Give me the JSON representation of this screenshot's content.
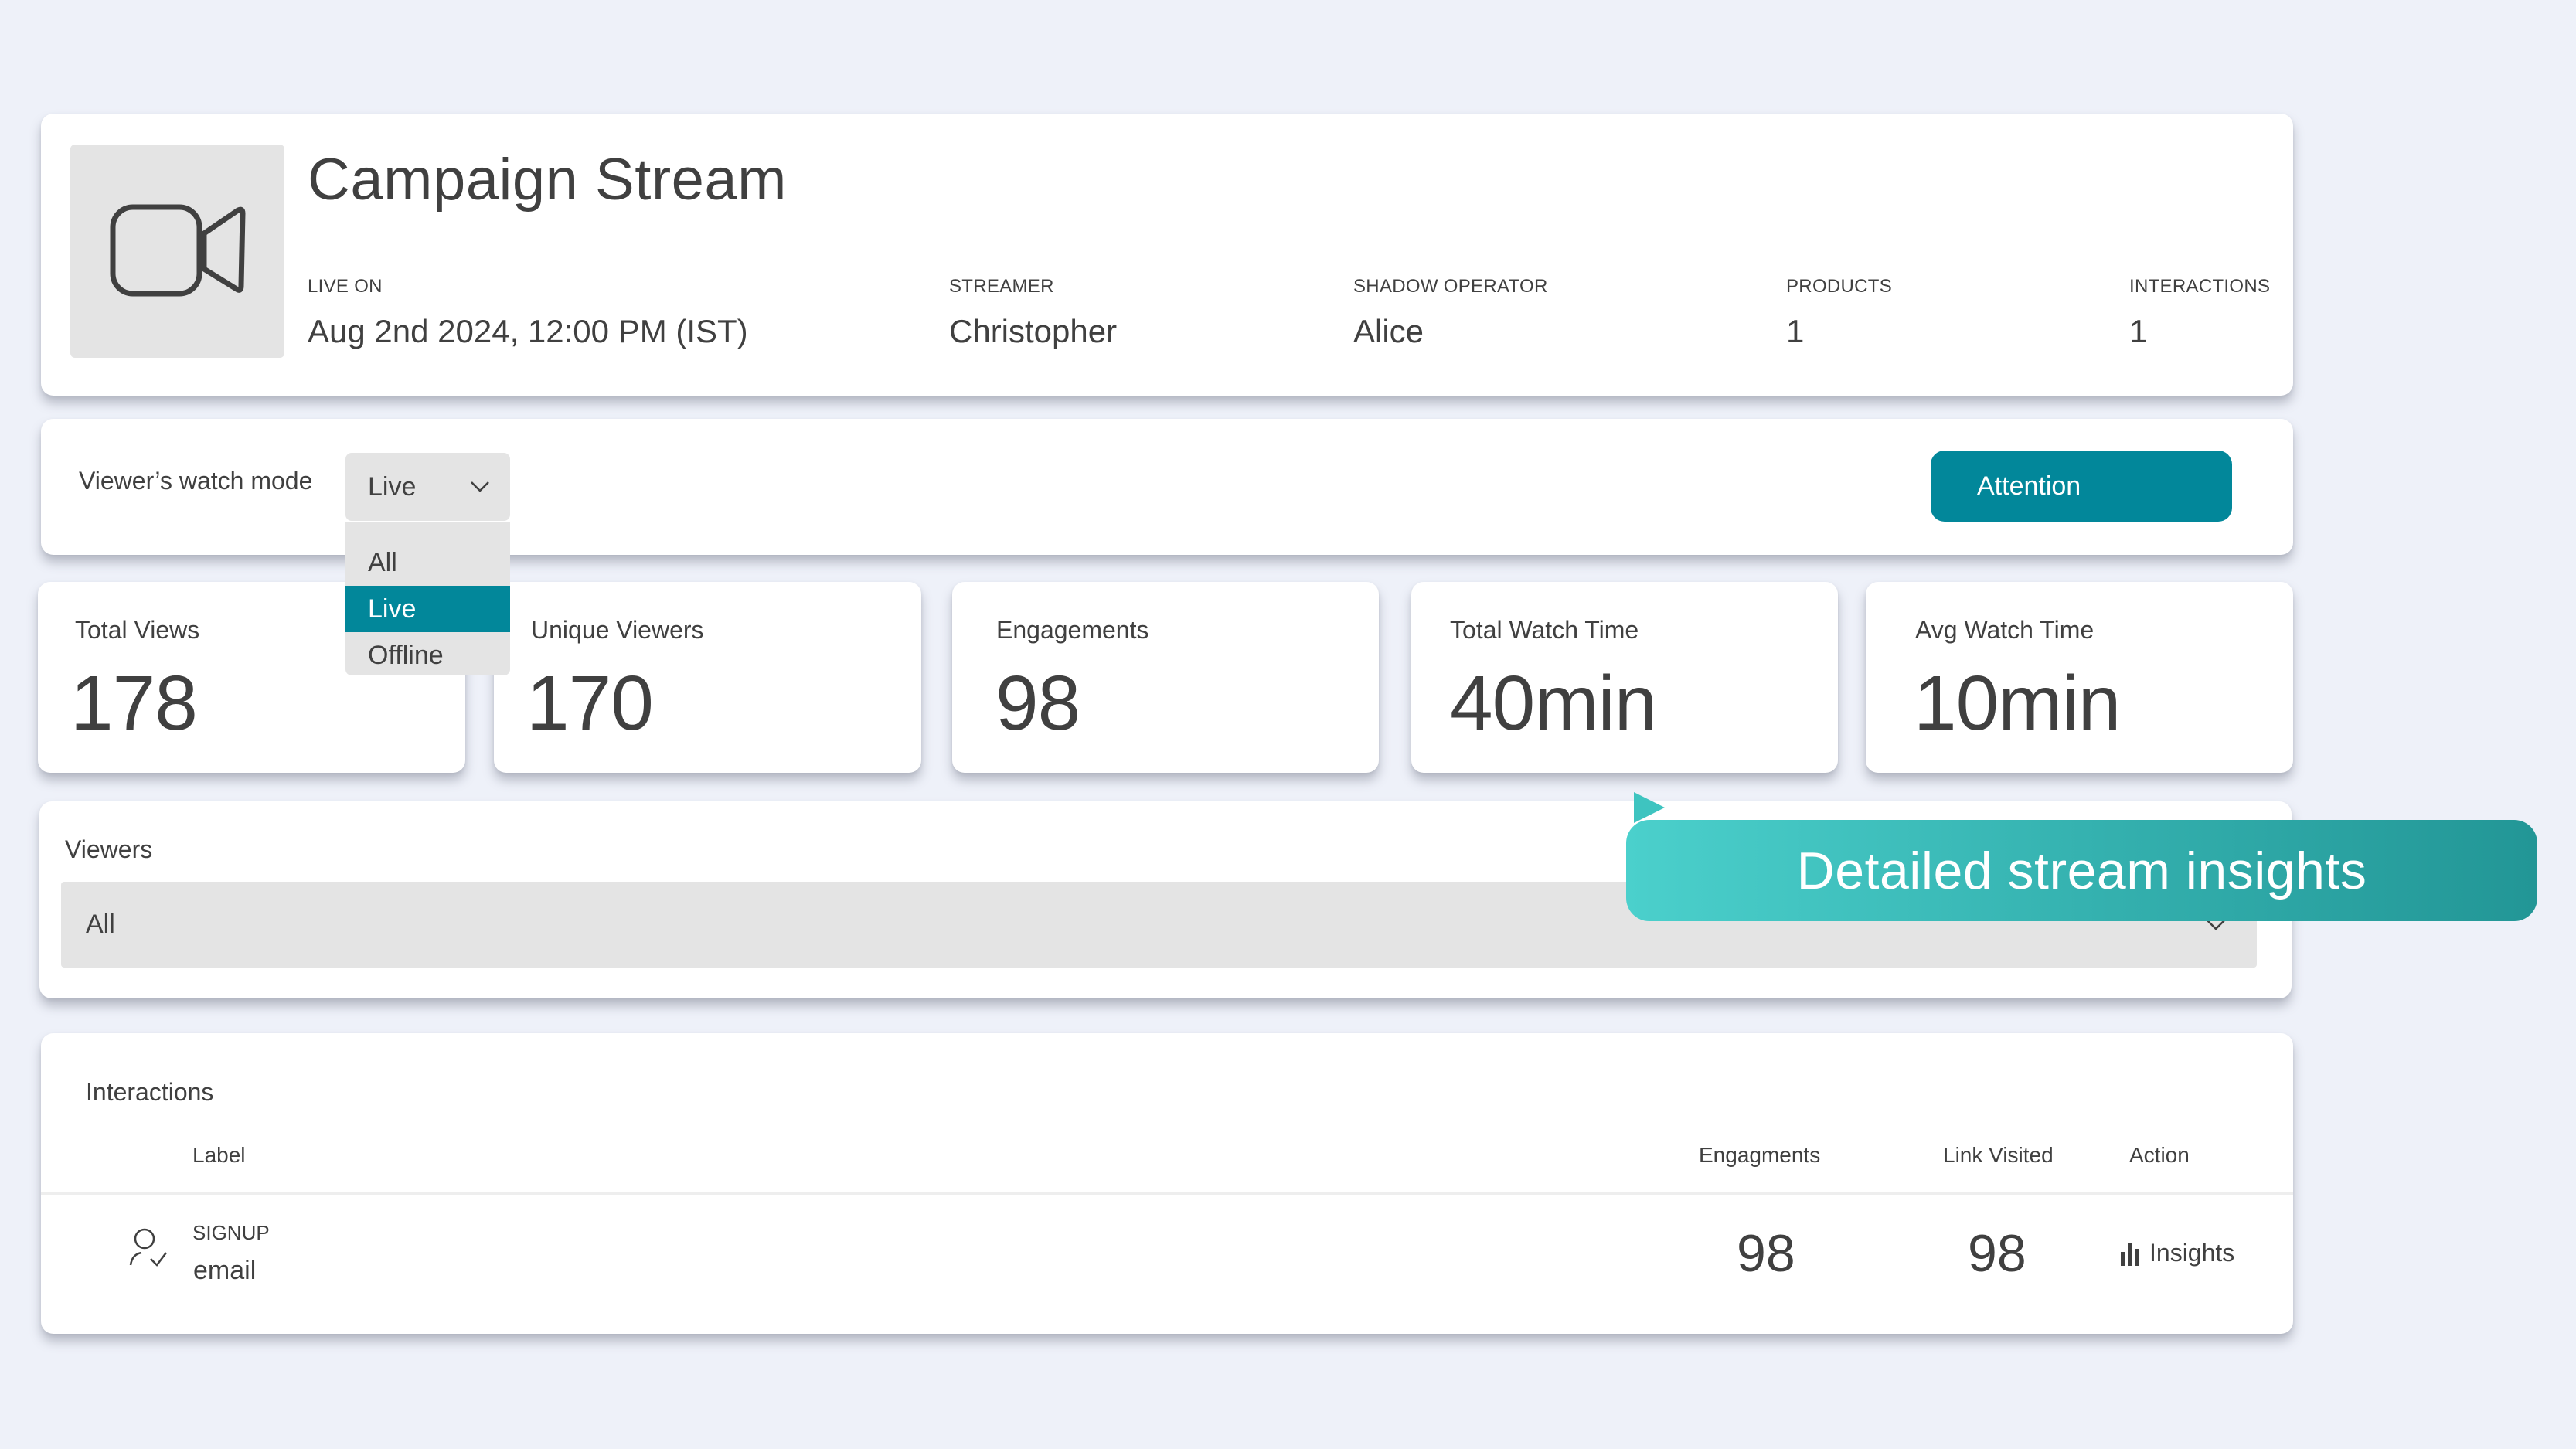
{
  "header": {
    "title": "Campaign Stream",
    "thumbnail_icon": "video-camera-icon",
    "meta": [
      {
        "label": "LIVE ON",
        "value": "Aug 2nd 2024, 12:00 PM (IST)"
      },
      {
        "label": "STREAMER",
        "value": "Christopher"
      },
      {
        "label": "SHADOW OPERATOR",
        "value": "Alice"
      },
      {
        "label": "PRODUCTS",
        "value": "1"
      },
      {
        "label": "INTERACTIONS",
        "value": "1"
      }
    ]
  },
  "watch_mode": {
    "label": "Viewer’s watch mode",
    "selected": "Live",
    "options": [
      "All",
      "Live",
      "Offline"
    ],
    "attention_button": "Attention"
  },
  "stats": [
    {
      "label": "Total Views",
      "value": "178"
    },
    {
      "label": "Unique Viewers",
      "value": "170"
    },
    {
      "label": "Engagements",
      "value": "98"
    },
    {
      "label": "Total Watch Time",
      "value": "40min"
    },
    {
      "label": "Avg Watch Time",
      "value": "10min"
    }
  ],
  "viewers": {
    "label": "Viewers",
    "selected": "All"
  },
  "tooltip": {
    "text": "Detailed stream insights"
  },
  "interactions": {
    "title": "Interactions",
    "columns": [
      "Label",
      "Engagments",
      "Link Visited",
      "Action"
    ],
    "rows": [
      {
        "icon": "user-check-icon",
        "type": "SIGNUP",
        "name": "email",
        "engagements": "98",
        "link_visited": "98",
        "action": "Insights"
      }
    ]
  },
  "colors": {
    "accent": "#02879a",
    "background": "#eef1f9",
    "tooltip_gradient_start": "#4bd0cc",
    "tooltip_gradient_end": "#229696"
  }
}
